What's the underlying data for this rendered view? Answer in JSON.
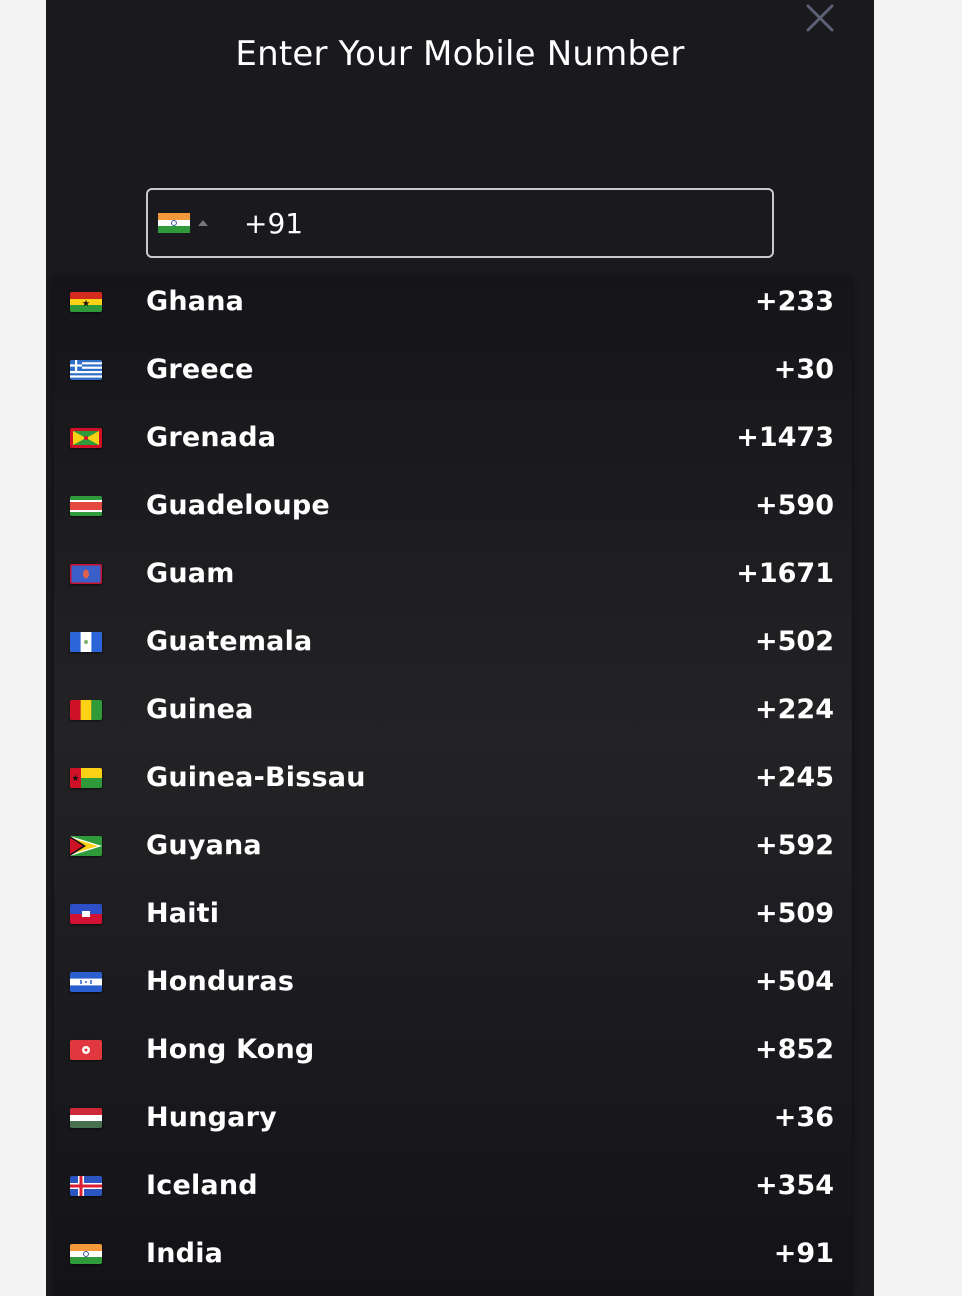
{
  "modal": {
    "title": "Enter Your Mobile Number",
    "close_icon": "close-icon"
  },
  "phone_field": {
    "selected_flag": "india-flag-icon",
    "value": "+91"
  },
  "countries": [
    {
      "name": "Ghana",
      "code": "+233",
      "flag": "ghana"
    },
    {
      "name": "Greece",
      "code": "+30",
      "flag": "greece"
    },
    {
      "name": "Grenada",
      "code": "+1473",
      "flag": "grenada"
    },
    {
      "name": "Guadeloupe",
      "code": "+590",
      "flag": "guadeloupe"
    },
    {
      "name": "Guam",
      "code": "+1671",
      "flag": "guam"
    },
    {
      "name": "Guatemala",
      "code": "+502",
      "flag": "guatemala"
    },
    {
      "name": "Guinea",
      "code": "+224",
      "flag": "guinea"
    },
    {
      "name": "Guinea-Bissau",
      "code": "+245",
      "flag": "guinea-bissau"
    },
    {
      "name": "Guyana",
      "code": "+592",
      "flag": "guyana"
    },
    {
      "name": "Haiti",
      "code": "+509",
      "flag": "haiti"
    },
    {
      "name": "Honduras",
      "code": "+504",
      "flag": "honduras"
    },
    {
      "name": "Hong Kong",
      "code": "+852",
      "flag": "hong-kong"
    },
    {
      "name": "Hungary",
      "code": "+36",
      "flag": "hungary"
    },
    {
      "name": "Iceland",
      "code": "+354",
      "flag": "iceland"
    },
    {
      "name": "India",
      "code": "+91",
      "flag": "india"
    }
  ]
}
